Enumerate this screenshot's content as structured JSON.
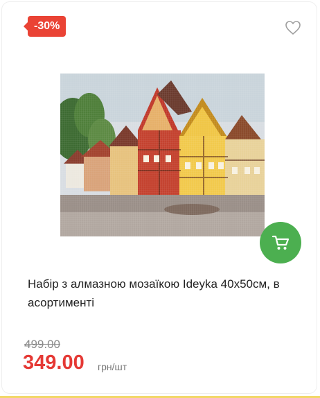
{
  "badge": {
    "discount": "-30%"
  },
  "icons": {
    "wishlist": "heart-outline-icon",
    "cart": "shopping-cart-icon"
  },
  "product": {
    "image_alt": "Diamond mosaic picture of colorful half-timbered houses",
    "title": "Набір з алмазною мозаїкою Ideyka 40x50см, в асортименті",
    "old_price": "499.00",
    "price": "349.00",
    "unit": "грн/шт"
  },
  "colors": {
    "discount_badge": "#ea4335",
    "cart_button": "#4caf50",
    "price": "#e53935"
  }
}
